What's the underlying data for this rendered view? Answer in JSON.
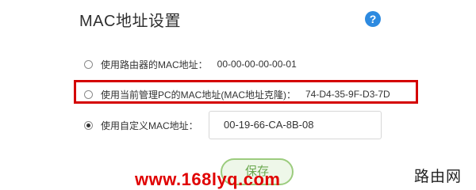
{
  "page": {
    "title": "MAC地址设置",
    "help_icon": "?"
  },
  "options": [
    {
      "label": "使用路由器的MAC地址：",
      "value": "00-00-00-00-00-01",
      "checked": false
    },
    {
      "label": "使用当前管理PC的MAC地址(MAC地址克隆)：",
      "value": "74-D4-35-9F-D3-7D",
      "checked": false
    },
    {
      "label": "使用自定义MAC地址：",
      "input_value": "00-19-66-CA-8B-08",
      "checked": true
    }
  ],
  "actions": {
    "save_label": "保存"
  },
  "watermark": {
    "url": "www.168lyq.com",
    "brand": "路由网"
  },
  "colors": {
    "highlight": "#d40000",
    "help": "#2d8ae0",
    "save_border": "#9ccc7e"
  }
}
